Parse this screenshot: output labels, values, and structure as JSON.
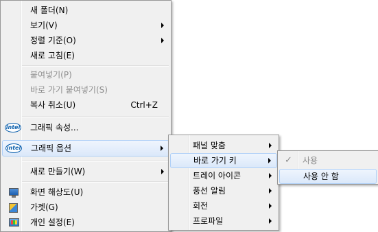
{
  "main_menu": {
    "items": [
      {
        "label": "새 폴더(N)"
      },
      {
        "label": "보기(V)"
      },
      {
        "label": "정렬 기준(O)"
      },
      {
        "label": "새로 고침(E)"
      },
      {
        "label": "붙여넣기(P)"
      },
      {
        "label": "바로 가기 붙여넣기(S)"
      },
      {
        "label": "복사 취소(U)",
        "shortcut": "Ctrl+Z"
      },
      {
        "label": "그래픽 속성...",
        "icon": "intel-logo-icon"
      },
      {
        "label": "그래픽 옵션",
        "icon": "intel-logo-icon"
      },
      {
        "label": "새로 만들기(W)"
      },
      {
        "label": "화면 해상도(U)",
        "icon": "monitor-icon"
      },
      {
        "label": "가젯(G)",
        "icon": "gadget-icon"
      },
      {
        "label": "개인 설정(E)",
        "icon": "personalize-icon"
      }
    ],
    "intel_logo_text": "intel"
  },
  "graphics_submenu": {
    "items": [
      {
        "label": "패널 맞춤"
      },
      {
        "label": "바로 가기 키"
      },
      {
        "label": "트레이 아이콘"
      },
      {
        "label": "풍선 알림"
      },
      {
        "label": "회전"
      },
      {
        "label": "프로파일"
      }
    ]
  },
  "hotkey_submenu": {
    "items": [
      {
        "label": "사용",
        "checked": true
      },
      {
        "label": "사용 안 함"
      }
    ],
    "check_glyph": "✓"
  },
  "colors": {
    "menu_bg": "#f0f0f0",
    "highlight": "#dbe8fa",
    "highlight_border": "#aecff7",
    "disabled_text": "#8d8d8d"
  }
}
